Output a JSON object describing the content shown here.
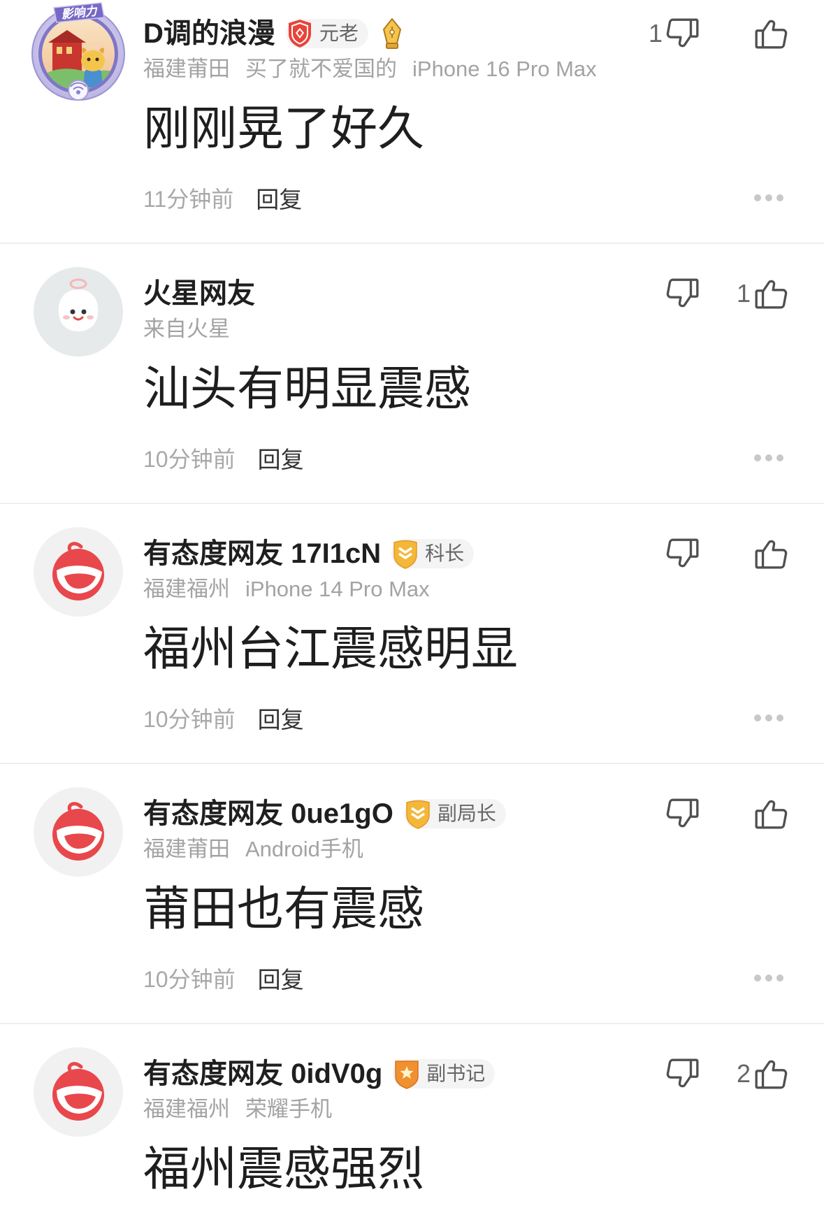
{
  "labels": {
    "reply": "回复"
  },
  "icons": {
    "dislike": "thumbs-down-icon",
    "like": "thumbs-up-icon",
    "more": "more-dots-icon"
  },
  "colors": {
    "background": "#ffffff",
    "text_primary": "#1f1f1f",
    "text_secondary": "#a3a3a3",
    "divider": "#eeeeee",
    "badge_background": "#f4f4f5",
    "accent_red": "#e8474c",
    "badge_gold": "#f4b73a",
    "badge_orange": "#f0902f"
  },
  "comments": [
    {
      "avatar": {
        "icon": "influence-frame-avatar",
        "frame_label": "影响力"
      },
      "username": "D调的浪漫",
      "badge": {
        "icon": "red-shield-diamond-icon",
        "label": "元老"
      },
      "extra_badge_icon": "gold-pen-nib-icon",
      "meta": [
        "福建莆田",
        "买了就不爱国的",
        "iPhone 16 Pro Max"
      ],
      "dislike_count": "1",
      "content": "刚刚晃了好久",
      "time": "11分钟前"
    },
    {
      "avatar": {
        "icon": "mars-mascot-avatar"
      },
      "username": "火星网友",
      "meta": [
        "来自火星"
      ],
      "like_count": "1",
      "content": "汕头有明显震感",
      "time": "10分钟前"
    },
    {
      "avatar": {
        "icon": "red-mascot-logo-avatar"
      },
      "username": "有态度网友 17I1cN",
      "badge": {
        "icon": "gold-chevron-shield-icon",
        "label": "科长"
      },
      "meta": [
        "福建福州",
        "iPhone 14 Pro Max"
      ],
      "content": "福州台江震感明显",
      "time": "10分钟前"
    },
    {
      "avatar": {
        "icon": "red-mascot-logo-avatar"
      },
      "username": "有态度网友 0ue1gO",
      "badge": {
        "icon": "gold-chevron-shield-icon",
        "label": "副局长"
      },
      "meta": [
        "福建莆田",
        "Android手机"
      ],
      "content": "莆田也有震感",
      "time": "10分钟前"
    },
    {
      "avatar": {
        "icon": "red-mascot-logo-avatar"
      },
      "username": "有态度网友 0idV0g",
      "badge": {
        "icon": "orange-star-shield-icon",
        "label": "副书记"
      },
      "meta": [
        "福建福州",
        "荣耀手机"
      ],
      "like_count": "2",
      "content": "福州震感强烈"
    }
  ]
}
